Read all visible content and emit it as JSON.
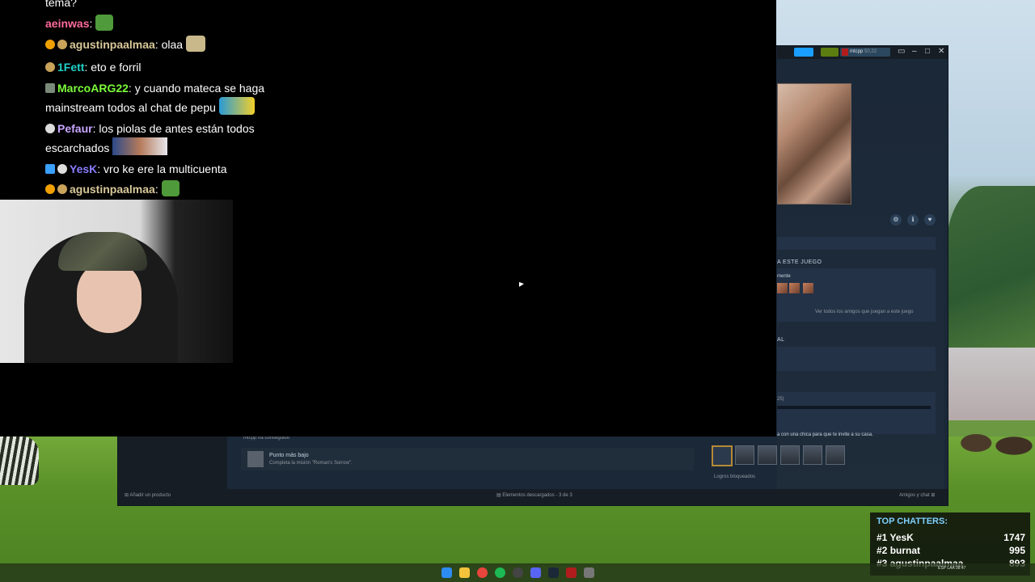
{
  "chat": {
    "messages": [
      {
        "user": "",
        "user_color": "#ffffff",
        "text": "tema?"
      },
      {
        "user": "aeinwas",
        "user_color": "#ff6b9a",
        "text": ""
      },
      {
        "user": "agustinpaalmaa",
        "user_color": "#d8c89a",
        "text": "olaa"
      },
      {
        "user": "1Fett",
        "user_color": "#1fd1c7",
        "text": "eto e forril"
      },
      {
        "user": "MarcoARG22",
        "user_color": "#7cfc3a",
        "text": "y cuando mateca se haga"
      },
      {
        "user": "",
        "user_color": "#ffffff",
        "text": "mainstream todos al chat de pepu"
      },
      {
        "user": "Pefaur",
        "user_color": "#c7a6ff",
        "text": "los piolas de antes están todos"
      },
      {
        "user": "",
        "user_color": "#ffffff",
        "text": "escarchados"
      },
      {
        "user": "YesK",
        "user_color": "#8a7dff",
        "text": "vro ke ere la multicuenta"
      },
      {
        "user": "agustinpaalmaa",
        "user_color": "#d8c89a",
        "text": ""
      }
    ]
  },
  "steam": {
    "username": "mtcpp",
    "wallet": "50,22",
    "section_friends": "A ESTE JUEGO",
    "friends_sub": "mente",
    "see_all_friends": "Ver todos los amigos que juegan a este juego",
    "section_al": "AL",
    "progress_text": "25)",
    "ach_desc_partial": "a con una chica para que te invite a su casa.",
    "locked_achievements": "Logros bloqueados",
    "recent_user_line": "mtcpp ha conseguido",
    "achievement_title": "Punto más bajo",
    "achievement_desc": "Completa la misión \"Roman's Sorrow\".",
    "add_product": "Añadir un producto",
    "downloads": "Elementos descargados - 3 de 3",
    "friends_chat": "Amigos y chat"
  },
  "top_chatters": {
    "title": "TOP CHATTERS:",
    "rows": [
      {
        "rank": "#1",
        "name": "YesK",
        "count": "1747"
      },
      {
        "rank": "#2",
        "name": "burnat",
        "count": "995"
      },
      {
        "rank": "#3",
        "name": "agustinpaalmaa",
        "count": "893"
      }
    ]
  },
  "taskbar": {
    "icons": [
      "windows-start-icon",
      "file-explorer-icon",
      "chrome-icon",
      "spotify-icon",
      "obs-icon",
      "discord-icon",
      "steam-icon",
      "game-icon",
      "app-icon"
    ],
    "tray_lang": "ESP",
    "tray_lang2": "LAA",
    "time": "08:47"
  },
  "colors": {
    "steam_bg": "#1b2838",
    "steam_accent_blue": "#1a9fff",
    "steam_green": "#5c7e10"
  }
}
